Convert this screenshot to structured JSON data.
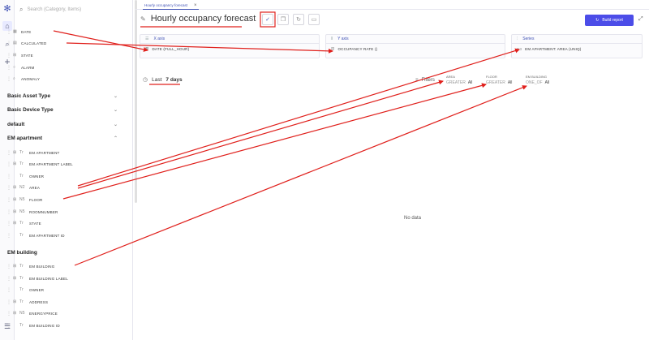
{
  "search": {
    "placeholder": "Search (Category, Items)"
  },
  "tab": {
    "label": "Hourly occupancy forecast",
    "close": "×"
  },
  "title": "Hourly occupancy forecast",
  "build_label": "Build report",
  "axes": {
    "x": {
      "title": "X axis",
      "value": "DATE (FULL_HOUR)"
    },
    "y": {
      "title": "Y axis",
      "value": "OCCUPANCY RATE ()"
    },
    "series": {
      "title": "Series",
      "value": "EM APARTMENT: AREA (UNIQ)"
    }
  },
  "date_range": {
    "prefix": "Last",
    "value": "7 days"
  },
  "filters_label": "Filters",
  "filter_chips": [
    {
      "name": "AREA",
      "op": "GREATER",
      "value": "All"
    },
    {
      "name": "FLOOR",
      "op": "GREATER",
      "value": "All"
    },
    {
      "name": "EM BUILDING",
      "op": "ONE_OF",
      "value": "All"
    }
  ],
  "no_data": "No data",
  "top_fields": [
    "DATE",
    "CALCULATED",
    "STATE",
    "ALARM",
    "ANOMALY"
  ],
  "sections": {
    "basic_asset": "Basic Asset Type",
    "basic_device": "Basic Device Type",
    "default": "default",
    "em_apartment": "EM apartment",
    "em_building": "EM building"
  },
  "apartment_fields": [
    "EM APARTMENT",
    "EM APARTMENT LABEL",
    "OWNER",
    "AREA",
    "FLOOR",
    "ROOMNUMBER",
    "STATE",
    "EM APARTMENT ID"
  ],
  "building_fields": [
    "EM BUILDING",
    "EM BUILDING LABEL",
    "OWNER",
    "ADDRESS",
    "ENERGYPRICE",
    "EM BUILDING ID"
  ],
  "annotation_color": "#e0201c",
  "accent_color": "#4c4de8"
}
